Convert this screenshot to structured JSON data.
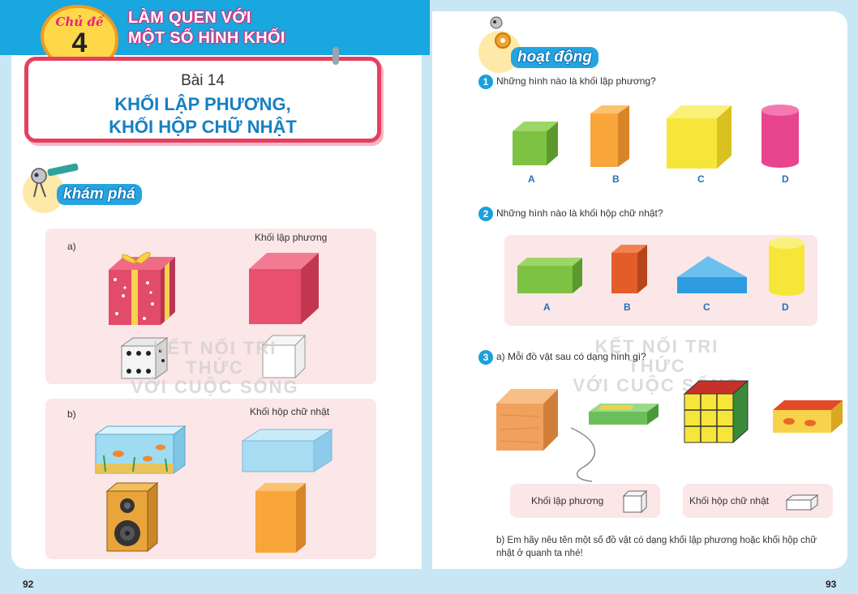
{
  "topic": {
    "badge_label": "Chủ đề",
    "badge_number": "4",
    "title_line1": "LÀM QUEN VỚI",
    "title_line2": "MỘT SỐ HÌNH KHỐI"
  },
  "lesson": {
    "number": "Bài 14",
    "title_line1": "KHỐI LẬP PHƯƠNG,",
    "title_line2": "KHỐI HỘP CHỮ NHẬT"
  },
  "explore": {
    "label": "khám phá",
    "panel_a": {
      "label": "a)",
      "caption": "Khối lập phương"
    },
    "panel_b": {
      "label": "b)",
      "caption": "Khối hộp chữ nhật"
    }
  },
  "watermark": {
    "line1": "KẾT NỐI TRI THỨC",
    "line2": "VỚI CUỘC SỐNG"
  },
  "activity": {
    "label": "hoạt động",
    "q1": {
      "number": "1",
      "text": "Những hình nào là khối lập phương?",
      "letters": [
        "A",
        "B",
        "C",
        "D"
      ]
    },
    "q2": {
      "number": "2",
      "text": "Những hình nào là khối hộp chữ nhật?",
      "letters": [
        "A",
        "B",
        "C",
        "D"
      ]
    },
    "q3": {
      "number": "3",
      "text_a": "a) Mỗi đồ vật sau có dạng hình gì?",
      "answer1": "Khối lập phương",
      "answer2": "Khối hộp chữ nhật",
      "text_b": "b)  Em hãy nêu tên một số đồ vật có dạng khối lập phương hoặc khối hộp chữ nhật ở quanh ta nhé!"
    }
  },
  "pages": {
    "left": "92",
    "right": "93"
  },
  "colors": {
    "banner": "#19a7df",
    "lesson_border": "#e4405f",
    "title_blue": "#1680c4",
    "panel_pink": "#fbe6e8",
    "q_badge": "#1aa0dd"
  }
}
